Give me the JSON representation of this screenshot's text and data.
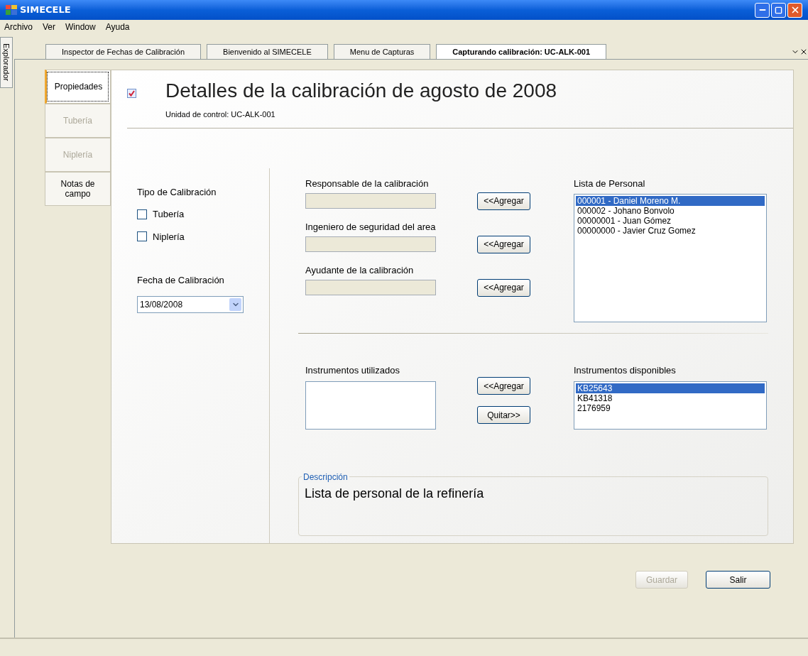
{
  "window": {
    "title": "SIMECELE"
  },
  "menu": [
    "Archivo",
    "Ver",
    "Window",
    "Ayuda"
  ],
  "explorer_tab": {
    "label": "Explorador"
  },
  "doc_tabs": [
    {
      "label": "Inspector de Fechas de Calibración",
      "selected": false
    },
    {
      "label": "Bienvenido al SIMECELE",
      "selected": false
    },
    {
      "label": "Menu de Capturas",
      "selected": false
    },
    {
      "label": "Capturando calibración: UC-ALK-001",
      "selected": true
    }
  ],
  "side_tabs": [
    {
      "label": "Propiedades",
      "selected": true,
      "disabled": false
    },
    {
      "label": "Tubería",
      "selected": false,
      "disabled": true
    },
    {
      "label": "Niplería",
      "selected": false,
      "disabled": true
    },
    {
      "label": "Notas de campo",
      "selected": false,
      "disabled": false
    }
  ],
  "header": {
    "title": "Detalles de la calibración de agosto de 2008",
    "subtitle": "Unidad de control: UC-ALK-001"
  },
  "tipo": {
    "label": "Tipo de Calibración",
    "options": [
      {
        "label": "Tubería",
        "checked": false
      },
      {
        "label": "Niplería",
        "checked": false
      }
    ]
  },
  "fecha": {
    "label": "Fecha de Calibración",
    "value": "13/08/2008"
  },
  "roles": [
    {
      "label": "Responsable de la calibración",
      "button": "<<Agregar"
    },
    {
      "label": "Ingeniero de seguridad del area",
      "button": "<<Agregar"
    },
    {
      "label": "Ayudante de la calibración",
      "button": "<<Agregar"
    }
  ],
  "personal": {
    "label": "Lista de Personal",
    "items": [
      {
        "text": "000001 - Daniel Moreno M.",
        "selected": true
      },
      {
        "text": "000002 - Johano Bonvolo",
        "selected": false
      },
      {
        "text": "00000001 - Juan Gómez",
        "selected": false
      },
      {
        "text": "00000000 - Javier Cruz Gomez",
        "selected": false
      }
    ]
  },
  "instrumentos_utilizados": {
    "label": "Instrumentos utilizados"
  },
  "instrument_buttons": [
    "<<Agregar",
    "Quitar>>"
  ],
  "instrumentos_disponibles": {
    "label": "Instrumentos disponibles",
    "items": [
      {
        "text": "KB25643",
        "selected": true
      },
      {
        "text": "KB41318",
        "selected": false
      },
      {
        "text": "2176959",
        "selected": false
      }
    ]
  },
  "descripcion": {
    "legend": "Descripción",
    "text": "Lista de personal de la refinería"
  },
  "footer_buttons": [
    {
      "label": "Guardar",
      "disabled": true
    },
    {
      "label": "Salir",
      "disabled": false
    }
  ]
}
